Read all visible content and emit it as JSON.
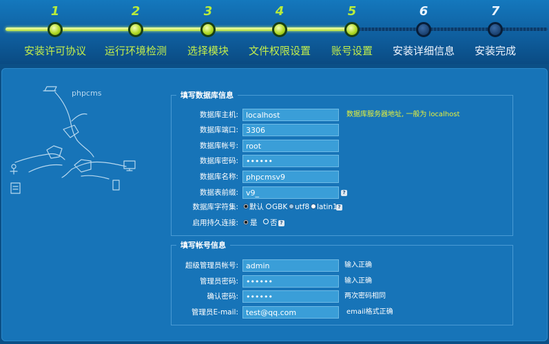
{
  "steps": [
    {
      "num": "1",
      "label": "安装许可协议",
      "state": "done"
    },
    {
      "num": "2",
      "label": "运行环境检测",
      "state": "done"
    },
    {
      "num": "3",
      "label": "选择模块",
      "state": "done"
    },
    {
      "num": "4",
      "label": "文件权限设置",
      "state": "done"
    },
    {
      "num": "5",
      "label": "账号设置",
      "state": "done"
    },
    {
      "num": "6",
      "label": "安装详细信息",
      "state": "todo"
    },
    {
      "num": "7",
      "label": "安装完成",
      "state": "todo"
    }
  ],
  "brand": "phpcms",
  "db_section": {
    "title": "填写数据库信息",
    "host_label": "数据库主机:",
    "host_value": "localhost",
    "host_hint": "数据库服务器地址, 一般为 localhost",
    "port_label": "数据库端口:",
    "port_value": "3306",
    "user_label": "数据库帐号:",
    "user_value": "root",
    "pass_label": "数据库密码:",
    "pass_value": "••••••",
    "name_label": "数据库名称:",
    "name_value": "phpcmsv9",
    "prefix_label": "数据表前缀:",
    "prefix_value": "v9_",
    "charset_label": "数据库字符集:",
    "charset_options": [
      "默认",
      "GBK",
      "utf8",
      "latin1"
    ],
    "charset_selected": "默认",
    "pconnect_label": "启用持久连接:",
    "pconnect_options": [
      "是",
      "否"
    ],
    "pconnect_selected": "是",
    "help_glyph": "?"
  },
  "admin_section": {
    "title": "填写帐号信息",
    "username_label": "超级管理员帐号:",
    "username_value": "admin",
    "username_hint": "输入正确",
    "password_label": "管理员密码:",
    "password_value": "••••••",
    "password_hint": "输入正确",
    "confirm_label": "确认密码:",
    "confirm_value": "••••••",
    "confirm_hint": "两次密码相同",
    "email_label": "管理员E-mail:",
    "email_value": "test@qq.com",
    "email_hint": "email格式正确"
  },
  "colors": {
    "step_done": "#b9ec3b",
    "step_todo": "#eaf4ff",
    "hint_yellow": "#e8f23a",
    "panel_bg": "#1774b8",
    "input_bg": "#3a9ed8"
  }
}
